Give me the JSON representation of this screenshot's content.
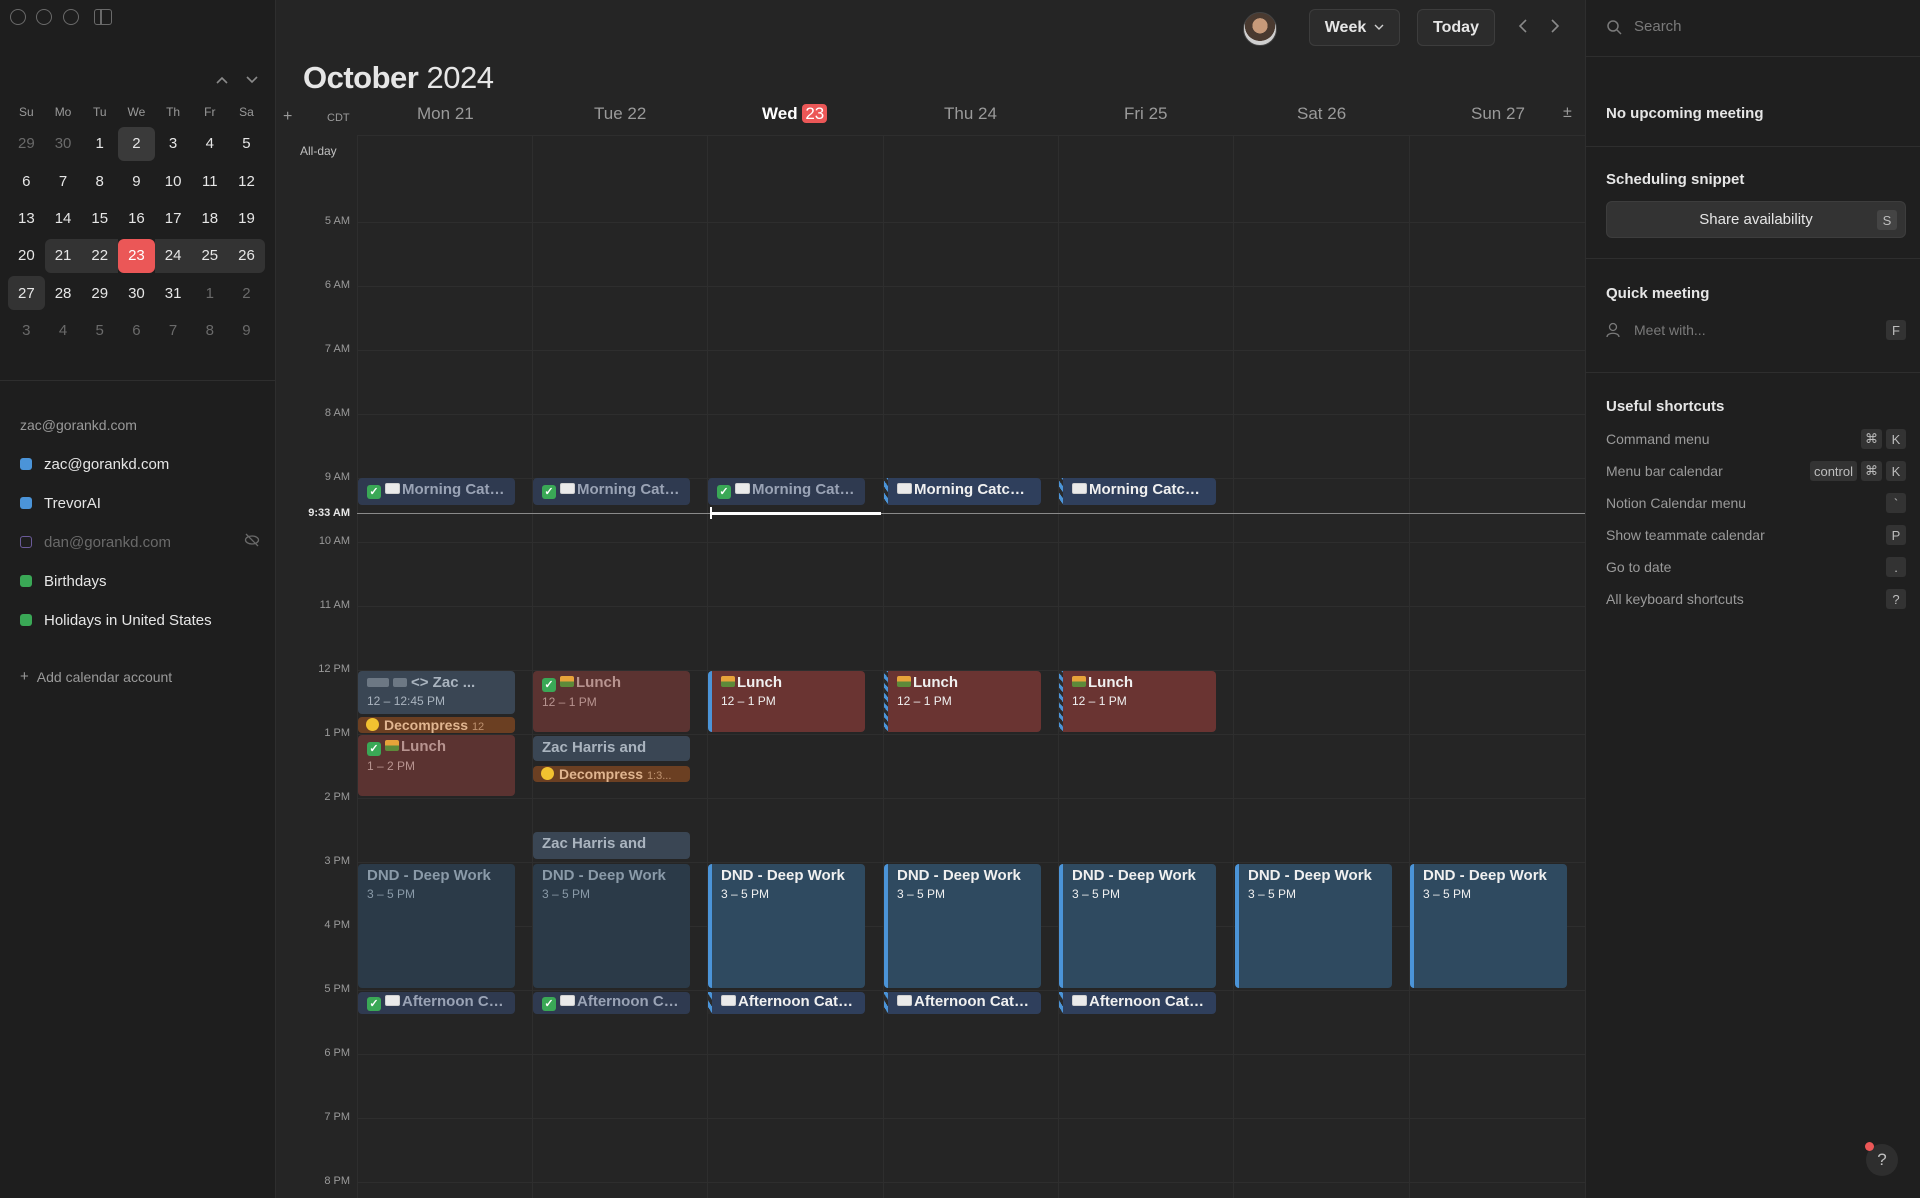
{
  "sidebar": {
    "weekday_headers": [
      "Su",
      "Mo",
      "Tu",
      "We",
      "Th",
      "Fr",
      "Sa"
    ],
    "weeks": [
      [
        "29",
        "30",
        "1",
        "2",
        "3",
        "4",
        "5"
      ],
      [
        "6",
        "7",
        "8",
        "9",
        "10",
        "11",
        "12"
      ],
      [
        "13",
        "14",
        "15",
        "16",
        "17",
        "18",
        "19"
      ],
      [
        "20",
        "21",
        "22",
        "23",
        "24",
        "25",
        "26"
      ],
      [
        "27",
        "28",
        "29",
        "30",
        "31",
        "1",
        "2"
      ],
      [
        "3",
        "4",
        "5",
        "6",
        "7",
        "8",
        "9"
      ]
    ],
    "account": "zac@gorankd.com",
    "calendars": [
      {
        "label": "zac@gorankd.com",
        "color": "#4b94d8"
      },
      {
        "label": "TrevorAI",
        "color": "#4b94d8"
      },
      {
        "label": "dan@gorankd.com",
        "color": "#6b5b9a"
      },
      {
        "label": "Birthdays",
        "color": "#3aa856"
      },
      {
        "label": "Holidays in United States",
        "color": "#3aa856"
      }
    ],
    "add_account": "Add calendar account"
  },
  "toolbar": {
    "view_label": "Week",
    "today_label": "Today"
  },
  "header": {
    "month": "October",
    "year": "2024",
    "timezone": "CDT",
    "days": [
      {
        "name": "Mon",
        "num": "21"
      },
      {
        "name": "Tue",
        "num": "22"
      },
      {
        "name": "Wed",
        "num": "23"
      },
      {
        "name": "Thu",
        "num": "24"
      },
      {
        "name": "Fri",
        "num": "25"
      },
      {
        "name": "Sat",
        "num": "26"
      },
      {
        "name": "Sun",
        "num": "27"
      }
    ],
    "allday_label": "All-day"
  },
  "hours": [
    "5 AM",
    "6 AM",
    "7 AM",
    "8 AM",
    "9 AM",
    "10 AM",
    "11 AM",
    "12 PM",
    "1 PM",
    "2 PM",
    "3 PM",
    "4 PM",
    "5 PM",
    "6 PM",
    "7 PM",
    "8 PM"
  ],
  "now_label": "9:33 AM",
  "events": {
    "morning_catch_mon": "Morning Catch",
    "morning_catch_tue": "Morning Catch",
    "morning_catch_wed": "Morning Catch",
    "morning_catch_thu": "Morning Catch Up",
    "morning_catch_fri": "Morning Catch Up",
    "zac_mon_title": "<> Zac ...",
    "zac_mon_time": "12 – 12:45 PM",
    "decompress_mon": "Decompress",
    "decompress_mon_time": "12",
    "lunch_mon": "Lunch",
    "lunch_mon_time": "1 – 2 PM",
    "lunch_tue": "Lunch",
    "lunch_tue_time": "12 – 1 PM",
    "lunch_wed": "Lunch",
    "lunch_wed_time": "12 – 1 PM",
    "lunch_thu": "Lunch",
    "lunch_thu_time": "12 – 1 PM",
    "lunch_fri": "Lunch",
    "lunch_fri_time": "12 – 1 PM",
    "zac_harris_1": "Zac Harris and",
    "decompress_tue": "Decompress",
    "decompress_tue_time": "1:3...",
    "zac_harris_2": "Zac Harris and",
    "dnd_title": "DND - Deep Work",
    "dnd_time": "3 – 5 PM",
    "afternoon_catch": "Afternoon Catch",
    "afternoon_catch_up": "Afternoon Catch Up"
  },
  "right_panel": {
    "search_placeholder": "Search",
    "upcoming": "No upcoming meeting",
    "scheduling_title": "Scheduling snippet",
    "share_label": "Share availability",
    "share_key": "S",
    "quick_title": "Quick meeting",
    "meet_placeholder": "Meet with...",
    "meet_key": "F",
    "shortcuts_title": "Useful shortcuts",
    "shortcuts": [
      {
        "label": "Command menu",
        "keys": [
          "⌘",
          "K"
        ]
      },
      {
        "label": "Menu bar calendar",
        "keys": [
          "control",
          "⌘",
          "K"
        ]
      },
      {
        "label": "Notion Calendar menu",
        "keys": [
          "`"
        ]
      },
      {
        "label": "Show teammate calendar",
        "keys": [
          "P"
        ]
      },
      {
        "label": "Go to date",
        "keys": [
          "."
        ]
      },
      {
        "label": "All keyboard shortcuts",
        "keys": [
          "?"
        ]
      }
    ],
    "help_label": "?"
  },
  "colors": {
    "accent_today": "#eb5757",
    "event_blue": "#4b94d8",
    "lunch_red": "#6a3432"
  }
}
